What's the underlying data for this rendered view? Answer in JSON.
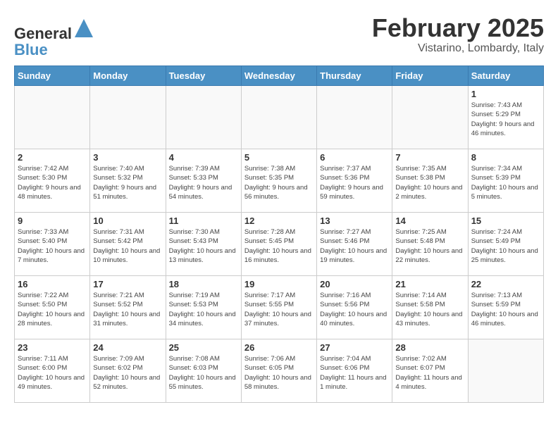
{
  "header": {
    "logo_general": "General",
    "logo_blue": "Blue",
    "month_year": "February 2025",
    "location": "Vistarino, Lombardy, Italy"
  },
  "days_of_week": [
    "Sunday",
    "Monday",
    "Tuesday",
    "Wednesday",
    "Thursday",
    "Friday",
    "Saturday"
  ],
  "weeks": [
    [
      {
        "day": "",
        "info": ""
      },
      {
        "day": "",
        "info": ""
      },
      {
        "day": "",
        "info": ""
      },
      {
        "day": "",
        "info": ""
      },
      {
        "day": "",
        "info": ""
      },
      {
        "day": "",
        "info": ""
      },
      {
        "day": "1",
        "info": "Sunrise: 7:43 AM\nSunset: 5:29 PM\nDaylight: 9 hours and 46 minutes."
      }
    ],
    [
      {
        "day": "2",
        "info": "Sunrise: 7:42 AM\nSunset: 5:30 PM\nDaylight: 9 hours and 48 minutes."
      },
      {
        "day": "3",
        "info": "Sunrise: 7:40 AM\nSunset: 5:32 PM\nDaylight: 9 hours and 51 minutes."
      },
      {
        "day": "4",
        "info": "Sunrise: 7:39 AM\nSunset: 5:33 PM\nDaylight: 9 hours and 54 minutes."
      },
      {
        "day": "5",
        "info": "Sunrise: 7:38 AM\nSunset: 5:35 PM\nDaylight: 9 hours and 56 minutes."
      },
      {
        "day": "6",
        "info": "Sunrise: 7:37 AM\nSunset: 5:36 PM\nDaylight: 9 hours and 59 minutes."
      },
      {
        "day": "7",
        "info": "Sunrise: 7:35 AM\nSunset: 5:38 PM\nDaylight: 10 hours and 2 minutes."
      },
      {
        "day": "8",
        "info": "Sunrise: 7:34 AM\nSunset: 5:39 PM\nDaylight: 10 hours and 5 minutes."
      }
    ],
    [
      {
        "day": "9",
        "info": "Sunrise: 7:33 AM\nSunset: 5:40 PM\nDaylight: 10 hours and 7 minutes."
      },
      {
        "day": "10",
        "info": "Sunrise: 7:31 AM\nSunset: 5:42 PM\nDaylight: 10 hours and 10 minutes."
      },
      {
        "day": "11",
        "info": "Sunrise: 7:30 AM\nSunset: 5:43 PM\nDaylight: 10 hours and 13 minutes."
      },
      {
        "day": "12",
        "info": "Sunrise: 7:28 AM\nSunset: 5:45 PM\nDaylight: 10 hours and 16 minutes."
      },
      {
        "day": "13",
        "info": "Sunrise: 7:27 AM\nSunset: 5:46 PM\nDaylight: 10 hours and 19 minutes."
      },
      {
        "day": "14",
        "info": "Sunrise: 7:25 AM\nSunset: 5:48 PM\nDaylight: 10 hours and 22 minutes."
      },
      {
        "day": "15",
        "info": "Sunrise: 7:24 AM\nSunset: 5:49 PM\nDaylight: 10 hours and 25 minutes."
      }
    ],
    [
      {
        "day": "16",
        "info": "Sunrise: 7:22 AM\nSunset: 5:50 PM\nDaylight: 10 hours and 28 minutes."
      },
      {
        "day": "17",
        "info": "Sunrise: 7:21 AM\nSunset: 5:52 PM\nDaylight: 10 hours and 31 minutes."
      },
      {
        "day": "18",
        "info": "Sunrise: 7:19 AM\nSunset: 5:53 PM\nDaylight: 10 hours and 34 minutes."
      },
      {
        "day": "19",
        "info": "Sunrise: 7:17 AM\nSunset: 5:55 PM\nDaylight: 10 hours and 37 minutes."
      },
      {
        "day": "20",
        "info": "Sunrise: 7:16 AM\nSunset: 5:56 PM\nDaylight: 10 hours and 40 minutes."
      },
      {
        "day": "21",
        "info": "Sunrise: 7:14 AM\nSunset: 5:58 PM\nDaylight: 10 hours and 43 minutes."
      },
      {
        "day": "22",
        "info": "Sunrise: 7:13 AM\nSunset: 5:59 PM\nDaylight: 10 hours and 46 minutes."
      }
    ],
    [
      {
        "day": "23",
        "info": "Sunrise: 7:11 AM\nSunset: 6:00 PM\nDaylight: 10 hours and 49 minutes."
      },
      {
        "day": "24",
        "info": "Sunrise: 7:09 AM\nSunset: 6:02 PM\nDaylight: 10 hours and 52 minutes."
      },
      {
        "day": "25",
        "info": "Sunrise: 7:08 AM\nSunset: 6:03 PM\nDaylight: 10 hours and 55 minutes."
      },
      {
        "day": "26",
        "info": "Sunrise: 7:06 AM\nSunset: 6:05 PM\nDaylight: 10 hours and 58 minutes."
      },
      {
        "day": "27",
        "info": "Sunrise: 7:04 AM\nSunset: 6:06 PM\nDaylight: 11 hours and 1 minute."
      },
      {
        "day": "28",
        "info": "Sunrise: 7:02 AM\nSunset: 6:07 PM\nDaylight: 11 hours and 4 minutes."
      },
      {
        "day": "",
        "info": ""
      }
    ]
  ]
}
